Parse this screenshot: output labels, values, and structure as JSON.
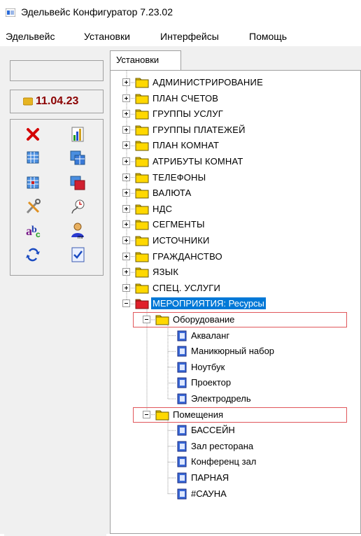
{
  "window": {
    "title": "Эдельвейс Конфигуратор 7.23.02"
  },
  "menu": [
    "Эдельвейс",
    "Установки",
    "Интерфейсы",
    "Помощь"
  ],
  "sidebar": {
    "date": "11.04.23",
    "tools": [
      "delete-icon",
      "chart-icon",
      "grid-icon",
      "grid-stack-icon",
      "grid-red-icon",
      "grid-stack-red-icon",
      "tools-icon",
      "clock-icon",
      "abc-icon",
      "user-icon",
      "refresh-icon",
      "checklist-icon"
    ]
  },
  "tabs": [
    "Установки"
  ],
  "tree": {
    "root_items": [
      "АДМИНИСТРИРОВАНИЕ",
      "ПЛАН СЧЕТОВ",
      "ГРУППЫ УСЛУГ",
      "ГРУППЫ ПЛАТЕЖЕЙ",
      "ПЛАН КОМНАТ",
      "АТРИБУТЫ КОМНАТ",
      "ТЕЛЕФОНЫ",
      "ВАЛЮТА",
      "НДС",
      "СЕГМЕНТЫ",
      "ИСТОЧНИКИ",
      "ГРАЖДАНСТВО",
      "ЯЗЫК",
      "СПЕЦ. УСЛУГИ"
    ],
    "selected_item": "МЕРОПРИЯТИЯ: Ресурсы",
    "groups": [
      {
        "label": "Оборудование",
        "items": [
          "Акваланг",
          "Маникюрный набор",
          "Ноутбук",
          "Проектор",
          "Электродрель"
        ]
      },
      {
        "label": "Помещения",
        "items": [
          "БАССЕЙН",
          "Зал ресторана",
          "Конференц зал",
          "ПАРНАЯ",
          "#САУНА"
        ]
      }
    ]
  },
  "colors": {
    "selection": "#0078d7",
    "highlight_border": "#e0575b",
    "folder_yellow": "#ffd800",
    "folder_red": "#e0202a",
    "date_text": "#8b0000"
  }
}
